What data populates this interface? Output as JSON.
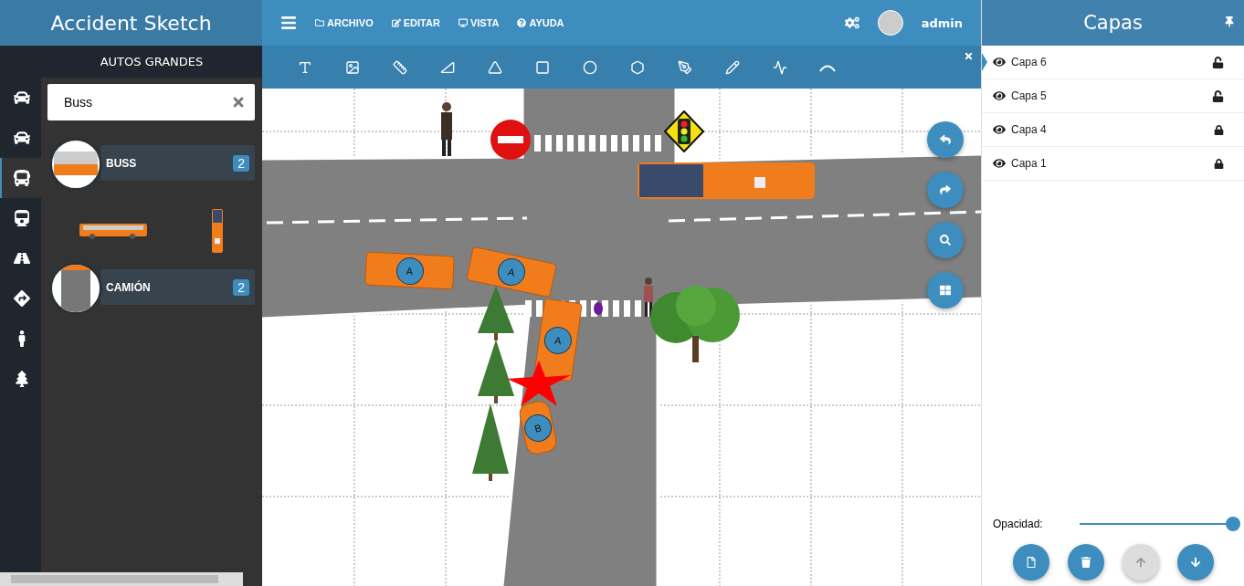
{
  "app_title": "Accident Sketch",
  "menu": [
    {
      "kind": "folder",
      "label": "ARCHIVO"
    },
    {
      "kind": "edit",
      "label": "EDITAR"
    },
    {
      "kind": "view",
      "label": "VISTA"
    },
    {
      "kind": "help",
      "label": "AYUDA"
    }
  ],
  "user": {
    "name": "admin"
  },
  "rail": [
    {
      "kind": "car",
      "selected": false
    },
    {
      "kind": "car",
      "selected": false
    },
    {
      "kind": "bus",
      "selected": true
    },
    {
      "kind": "train",
      "selected": false
    },
    {
      "kind": "road",
      "selected": false
    },
    {
      "kind": "sign",
      "selected": false
    },
    {
      "kind": "person",
      "selected": false
    },
    {
      "kind": "tree",
      "selected": false
    }
  ],
  "panel": {
    "title": "AUTOS GRANDES",
    "search": {
      "value": "Buss"
    },
    "categories": [
      {
        "kind": "bus",
        "label": "BUSS",
        "count": "2",
        "items": [
          {
            "kind": "bus-side"
          },
          {
            "kind": "bus-top"
          }
        ]
      },
      {
        "kind": "truck",
        "label": "CAMIÓN",
        "count": "2"
      }
    ]
  },
  "canvas": {
    "vehicles": [
      {
        "kind": "van",
        "label": "A"
      },
      {
        "kind": "van",
        "label": "A"
      },
      {
        "kind": "van",
        "label": "A"
      },
      {
        "kind": "car",
        "label": "B"
      },
      {
        "kind": "bus"
      }
    ]
  },
  "layers": {
    "title": "Capas",
    "items": [
      {
        "name": "Capa 6",
        "locked": false,
        "selected": true
      },
      {
        "name": "Capa 5",
        "locked": false,
        "selected": false
      },
      {
        "name": "Capa 4",
        "locked": true,
        "selected": false
      },
      {
        "name": "Capa 1",
        "locked": true,
        "selected": false
      }
    ],
    "opacity": {
      "label": "Opacidad:",
      "level": 1
    },
    "buttons": [
      {
        "kind": "new",
        "disabled": false
      },
      {
        "kind": "delete",
        "disabled": false
      },
      {
        "kind": "up",
        "disabled": true
      },
      {
        "kind": "down",
        "disabled": false
      }
    ]
  }
}
